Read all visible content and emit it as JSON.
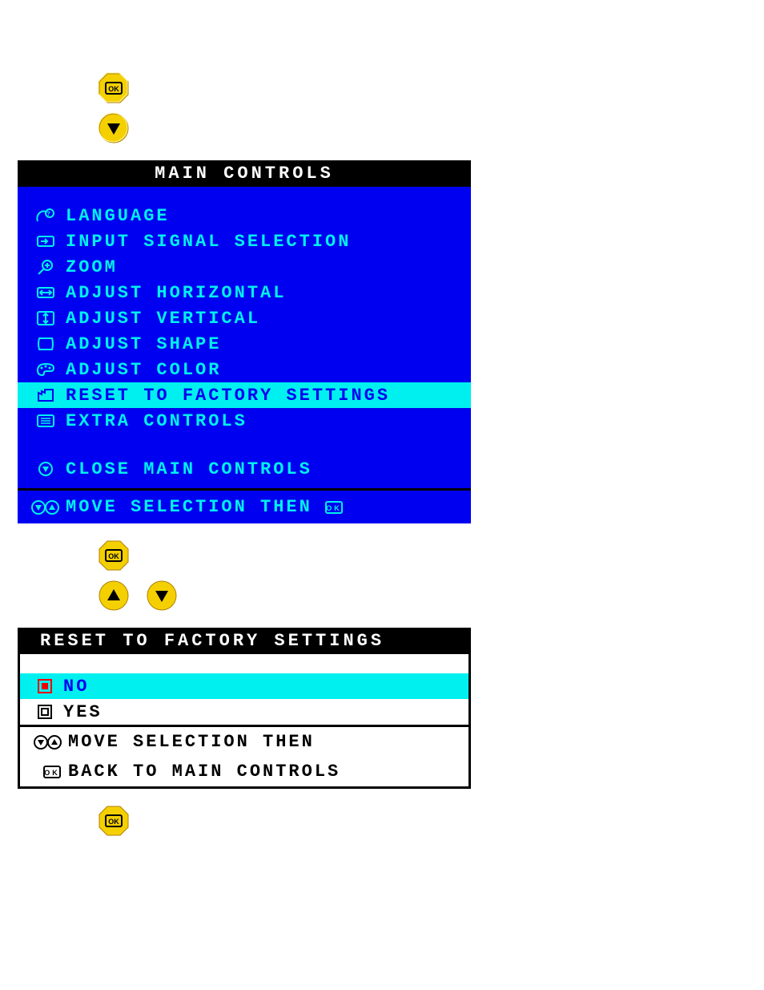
{
  "main_controls": {
    "title": "MAIN CONTROLS",
    "items": [
      {
        "label": "LANGUAGE"
      },
      {
        "label": "INPUT SIGNAL SELECTION"
      },
      {
        "label": "ZOOM"
      },
      {
        "label": "ADJUST HORIZONTAL"
      },
      {
        "label": "ADJUST VERTICAL"
      },
      {
        "label": "ADJUST SHAPE"
      },
      {
        "label": "ADJUST COLOR"
      },
      {
        "label": "RESET TO FACTORY SETTINGS"
      },
      {
        "label": "EXTRA CONTROLS"
      }
    ],
    "close_label": "CLOSE MAIN CONTROLS",
    "footer_label": "MOVE SELECTION THEN"
  },
  "reset_panel": {
    "title": "RESET TO FACTORY SETTINGS",
    "options": {
      "no": "NO",
      "yes": "YES"
    },
    "footer1": "MOVE SELECTION THEN",
    "footer2": "BACK TO MAIN CONTROLS"
  }
}
